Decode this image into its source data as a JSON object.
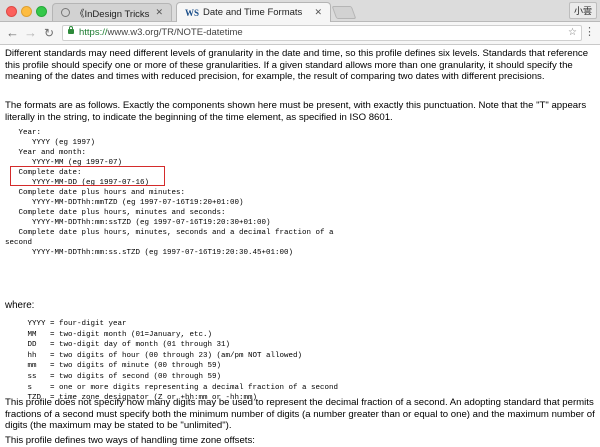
{
  "browser": {
    "tabs": [
      {
        "title": "《InDesign Tricks：專家愛用的",
        "active": false,
        "icon": "globe-icon"
      },
      {
        "title": "Date and Time Formats",
        "active": true,
        "icon": "w3c-icon",
        "favicon_text": "WS"
      }
    ],
    "user_chip": "小雲",
    "url_scheme": "https://",
    "url_host": "www.w3.org",
    "url_path": "/TR/NOTE-datetime"
  },
  "page": {
    "intro": "Different standards may need different levels of granularity in the date and time, so this profile defines six levels. Standards that reference this profile should specify one or more of these granularities. If a given standard allows more than one granularity, it should specify the meaning of the dates and times with reduced precision, for example, the result of comparing two dates with different precisions.",
    "formats_intro": "The formats are as follows. Exactly the components shown here must be present, with exactly this punctuation. Note that the \"T\" appears literally in the string, to indicate the beginning of the time element, as specified in ISO 8601.",
    "formats_block": "   Year:\n      YYYY (eg 1997)\n   Year and month:\n      YYYY-MM (eg 1997-07)\n   Complete date:\n      YYYY-MM-DD (eg 1997-07-16)\n   Complete date plus hours and minutes:\n      YYYY-MM-DDThh:mmTZD (eg 1997-07-16T19:20+01:00)\n   Complete date plus hours, minutes and seconds:\n      YYYY-MM-DDThh:mm:ssTZD (eg 1997-07-16T19:20:30+01:00)\n   Complete date plus hours, minutes, seconds and a decimal fraction of a\nsecond\n      YYYY-MM-DDThh:mm:ss.sTZD (eg 1997-07-16T19:20:30.45+01:00)",
    "where_label": "where:",
    "definitions_block": "     YYYY = four-digit year\n     MM   = two-digit month (01=January, etc.)\n     DD   = two-digit day of month (01 through 31)\n     hh   = two digits of hour (00 through 23) (am/pm NOT allowed)\n     mm   = two digits of minute (00 through 59)\n     ss   = two digits of second (00 through 59)\n     s    = one or more digits representing a decimal fraction of a second\n     TZD  = time zone designator (Z or +hh:mm or -hh:mm)",
    "fraction_para": "This profile does not specify how many digits may be used to represent the decimal fraction of a second. An adopting standard that permits fractions of a second must specify both the minimum number of digits (a number greater than or equal to one) and the maximum number of digits (the maximum may be stated to be \"unlimited\").",
    "timezone_para": "This profile defines two ways of handling time zone offsets:"
  },
  "annotation": {
    "color": "#d42b2b",
    "highlighted": "Complete date"
  }
}
